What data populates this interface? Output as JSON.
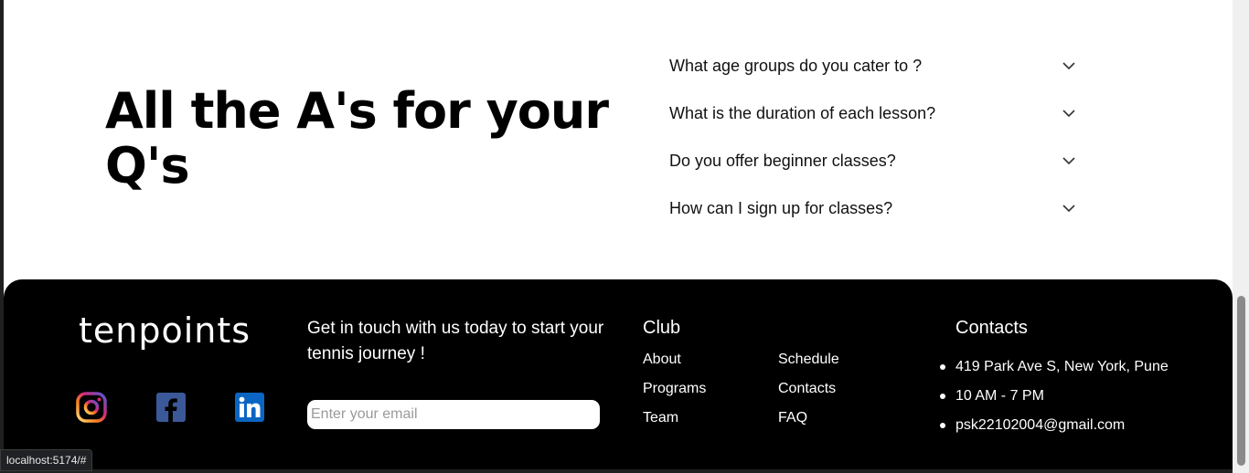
{
  "faq": {
    "heading": "All the A's for your Q's",
    "items": [
      {
        "question": "What age groups do you cater to ?"
      },
      {
        "question": "What is the duration of each lesson?"
      },
      {
        "question": "Do you offer beginner classes?"
      },
      {
        "question": "How can I sign up for classes?"
      }
    ]
  },
  "footer": {
    "logo": "tenpoints",
    "cta": "Get in touch with us today to start your tennis journey !",
    "email_placeholder": "Enter your email",
    "social": [
      {
        "name": "instagram",
        "icon": "instagram-icon"
      },
      {
        "name": "facebook",
        "icon": "facebook-icon",
        "color": "#3b5998"
      },
      {
        "name": "linkedin",
        "icon": "linkedin-icon",
        "color": "#0a66c2"
      }
    ],
    "club": {
      "title": "Club",
      "links": [
        "About",
        "Programs",
        "Team",
        "Schedule",
        "Contacts",
        "FAQ"
      ]
    },
    "contacts": {
      "title": "Contacts",
      "items": [
        "419 Park Ave S, New York, Pune",
        "10 AM - 7 PM",
        "psk22102004@gmail.com"
      ]
    }
  },
  "status_bar": {
    "url": "localhost:5174/#"
  }
}
